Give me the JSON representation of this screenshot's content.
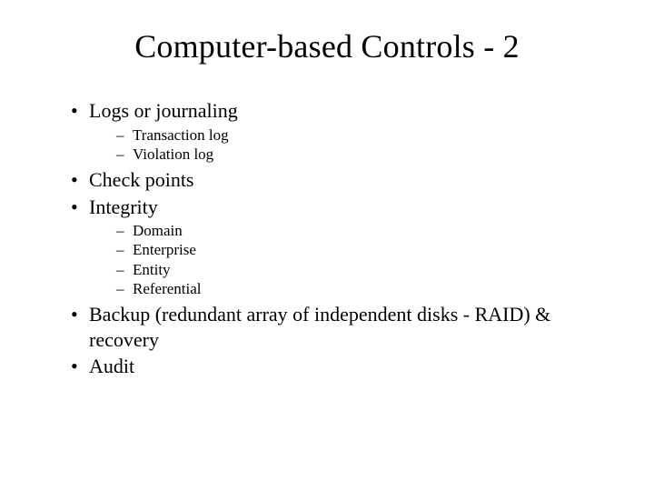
{
  "title": "Computer-based Controls - 2",
  "bullets": {
    "b0": {
      "text": "Logs or journaling"
    },
    "b0_sub": [
      "Transaction log",
      "Violation log"
    ],
    "b1": {
      "text": "Check points"
    },
    "b2": {
      "text": "Integrity"
    },
    "b2_sub": [
      "Domain",
      "Enterprise",
      "Entity",
      "Referential"
    ],
    "b3": {
      "text": "Backup (redundant array of independent disks - RAID) & recovery"
    },
    "b4": {
      "text": "Audit"
    }
  }
}
